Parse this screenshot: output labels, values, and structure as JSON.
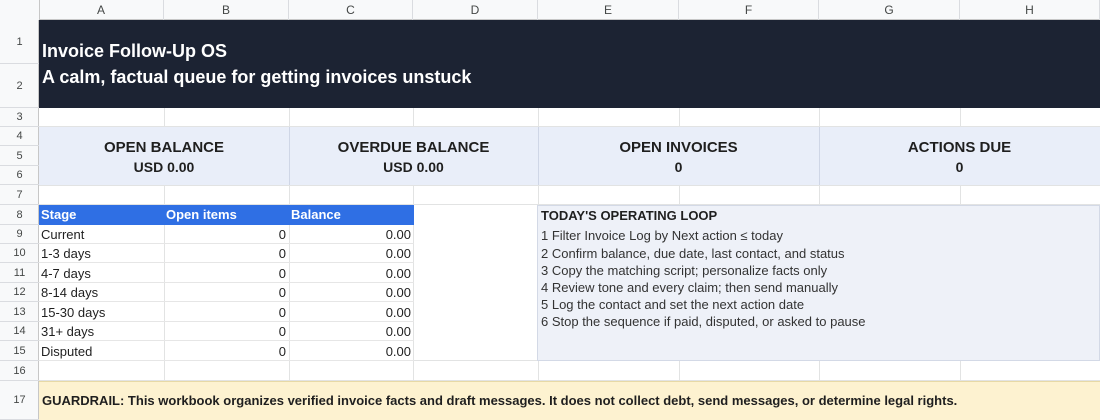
{
  "columns": [
    "A",
    "B",
    "C",
    "D",
    "E",
    "F",
    "G",
    "H"
  ],
  "rows": [
    "1",
    "2",
    "3",
    "4",
    "5",
    "6",
    "7",
    "8",
    "9",
    "10",
    "11",
    "12",
    "13",
    "14",
    "15",
    "16",
    "17"
  ],
  "banner": {
    "title": "Invoice Follow-Up OS",
    "subtitle": "A calm, factual queue for getting invoices unstuck",
    "bg_color": "#1c2333"
  },
  "kpis": [
    {
      "label": "OPEN BALANCE",
      "value": "USD 0.00"
    },
    {
      "label": "OVERDUE BALANCE",
      "value": "USD 0.00"
    },
    {
      "label": "OPEN INVOICES",
      "value": "0"
    },
    {
      "label": "ACTIONS DUE",
      "value": "0"
    }
  ],
  "aging_table": {
    "headers": [
      "Stage",
      "Open items",
      "Balance"
    ],
    "header_color": "#2f6fe4",
    "rows": [
      {
        "stage": "Current",
        "open_items": "0",
        "balance": "0.00"
      },
      {
        "stage": "1-3 days",
        "open_items": "0",
        "balance": "0.00"
      },
      {
        "stage": "4-7 days",
        "open_items": "0",
        "balance": "0.00"
      },
      {
        "stage": "8-14 days",
        "open_items": "0",
        "balance": "0.00"
      },
      {
        "stage": "15-30 days",
        "open_items": "0",
        "balance": "0.00"
      },
      {
        "stage": "31+ days",
        "open_items": "0",
        "balance": "0.00"
      },
      {
        "stage": "Disputed",
        "open_items": "0",
        "balance": "0.00"
      }
    ]
  },
  "operating_loop": {
    "title": "TODAY'S OPERATING LOOP",
    "steps": [
      "1  Filter Invoice Log by Next action ≤ today",
      "2  Confirm balance, due date, last contact, and status",
      "3  Copy the matching script; personalize facts only",
      "4  Review tone and every claim; then send manually",
      "5  Log the contact and set the next action date",
      "6  Stop the sequence if paid, disputed, or asked to pause"
    ]
  },
  "guardrail": {
    "text": "GUARDRAIL: This workbook organizes verified invoice facts and draft messages. It does not collect debt, send messages, or determine legal rights.",
    "bg_color": "#fdf2d0"
  }
}
